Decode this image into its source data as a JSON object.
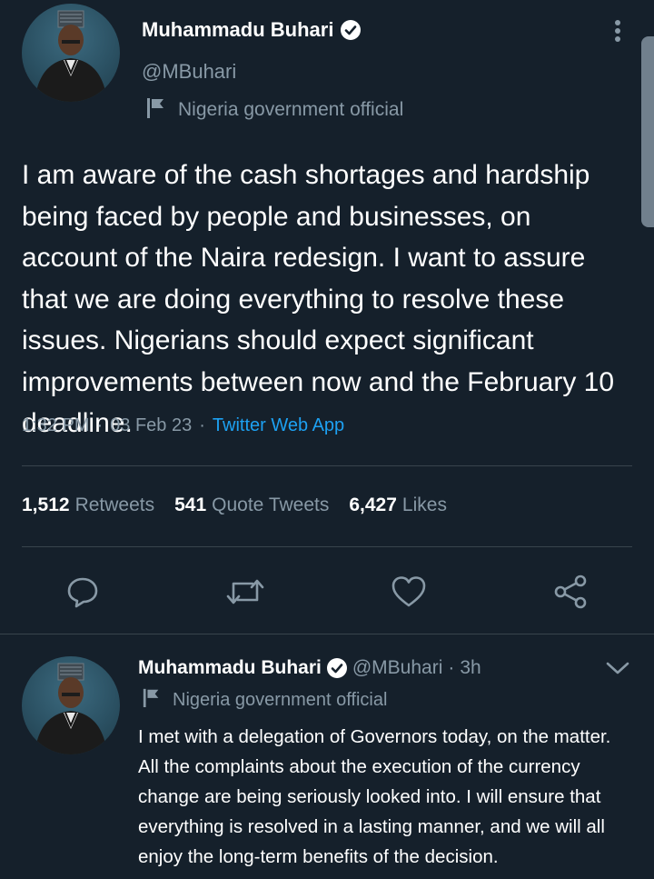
{
  "main_tweet": {
    "author_name": "Muhammadu Buhari",
    "handle": "@MBuhari",
    "label": "Nigeria government official",
    "text": "I am aware of the cash shortages and hardship being faced by people and businesses, on account of the Naira redesign. I want to assure that we are doing everything to resolve these issues. Nigerians should expect significant improvements between now and the February 10 deadline.",
    "time": "1:32 PM",
    "date": "03 Feb 23",
    "source": "Twitter Web App",
    "stats": {
      "retweets_count": "1,512",
      "retweets_label": "Retweets",
      "quotes_count": "541",
      "quotes_label": "Quote Tweets",
      "likes_count": "6,427",
      "likes_label": "Likes"
    }
  },
  "reply_tweet": {
    "author_name": "Muhammadu Buhari",
    "handle": "@MBuhari",
    "time_ago": "3h",
    "label": "Nigeria government official",
    "text": "I met with a delegation of Governors today, on the matter. All the complaints about the execution of the currency change are being seriously looked into. I will ensure that everything is resolved in a lasting manner, and we will all enjoy the long-term benefits of the decision."
  },
  "separators": {
    "dot": "·"
  },
  "icons": {
    "more": "more-vertical-icon",
    "verified": "verified-badge-icon",
    "flag": "flag-icon",
    "reply": "reply-icon",
    "retweet": "retweet-icon",
    "like": "heart-icon",
    "share": "share-icon",
    "chevron": "chevron-down-icon"
  },
  "colors": {
    "background": "#15202b",
    "text": "#ffffff",
    "muted": "#8899a6",
    "link": "#1da1f2",
    "divider": "#38444d"
  }
}
